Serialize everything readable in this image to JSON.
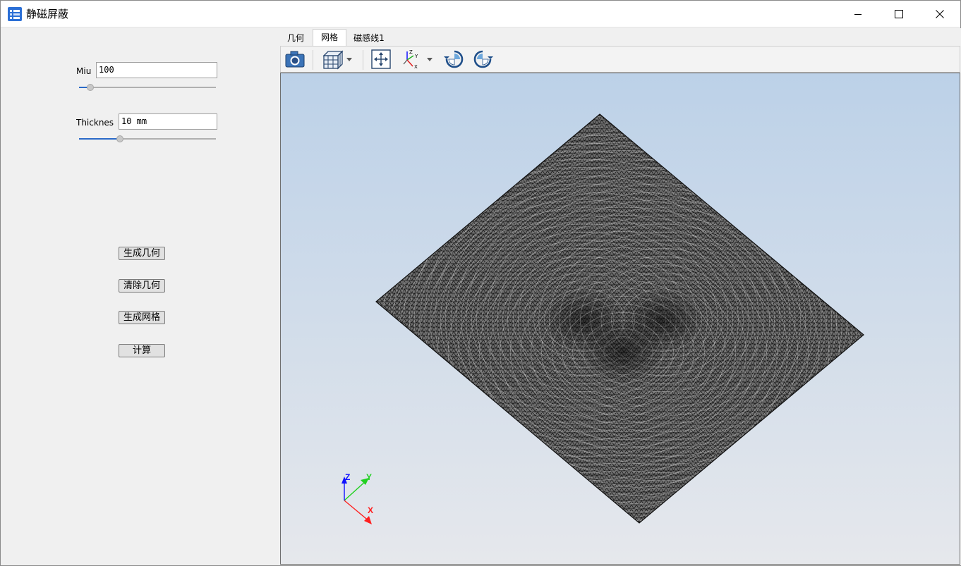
{
  "window": {
    "title": "静磁屏蔽",
    "controls": [
      "minimize-icon",
      "maximize-icon",
      "close-icon"
    ]
  },
  "params": {
    "miu": {
      "label": "Miu",
      "value": "100",
      "slider_fraction": 0.08
    },
    "thickness": {
      "label": "Thickness",
      "value": "10 mm",
      "slider_fraction": 0.3
    }
  },
  "buttons": {
    "generate_geometry": "生成几何",
    "clear_geometry": "清除几何",
    "generate_mesh": "生成网格",
    "compute": "计算"
  },
  "tabs": [
    {
      "label": "几何",
      "active": false
    },
    {
      "label": "网格",
      "active": true
    },
    {
      "label": "磁感线1",
      "active": false
    }
  ],
  "toolbar": {
    "icons": [
      "camera-icon",
      "view-cube-icon",
      "fit-view-icon",
      "axes-orientation-icon",
      "rotate-cw-icon",
      "rotate-ccw-icon"
    ]
  },
  "axes": {
    "x": "X",
    "y": "Y",
    "z": "Z"
  },
  "colors": {
    "viewport_top": "#bcd1e8",
    "viewport_bottom": "#e6e8ec",
    "mesh_fill": "#6b6b6b",
    "mesh_line": "#111111",
    "axis_x": "#ff2020",
    "axis_y": "#20d020",
    "axis_z": "#1010ff"
  }
}
